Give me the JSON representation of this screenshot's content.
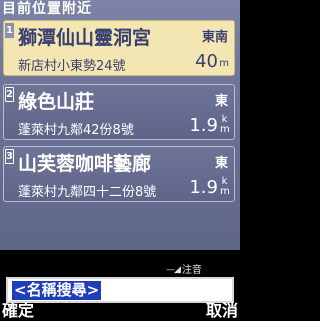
{
  "header": {
    "title": "目前位置附近"
  },
  "list": [
    {
      "index": "1",
      "name": "獅潭仙山靈洞宮",
      "direction": "東南",
      "address": "新店村小東勢24號",
      "distance": "40",
      "unit": "m",
      "selected": true
    },
    {
      "index": "2",
      "name": "綠色山莊",
      "direction": "東",
      "address": "蓬萊村九鄰42份8號",
      "distance": "1.9",
      "unit": "km",
      "selected": false
    },
    {
      "index": "3",
      "name": "山芙蓉咖啡藝廊",
      "direction": "東",
      "address": "蓬萊村九鄰四十二份8號",
      "distance": "1.9",
      "unit": "km",
      "selected": false
    }
  ],
  "input_mode": {
    "label": "注音",
    "icon": "keyboard-input-icon"
  },
  "search": {
    "value": "<名稱搜尋>"
  },
  "softkeys": {
    "left": "確定",
    "right": "取消"
  },
  "colors": {
    "selected_bg": "#f3e6b3",
    "panel_bg": "#6f7699",
    "search_highlight": "#1f3fb8"
  }
}
